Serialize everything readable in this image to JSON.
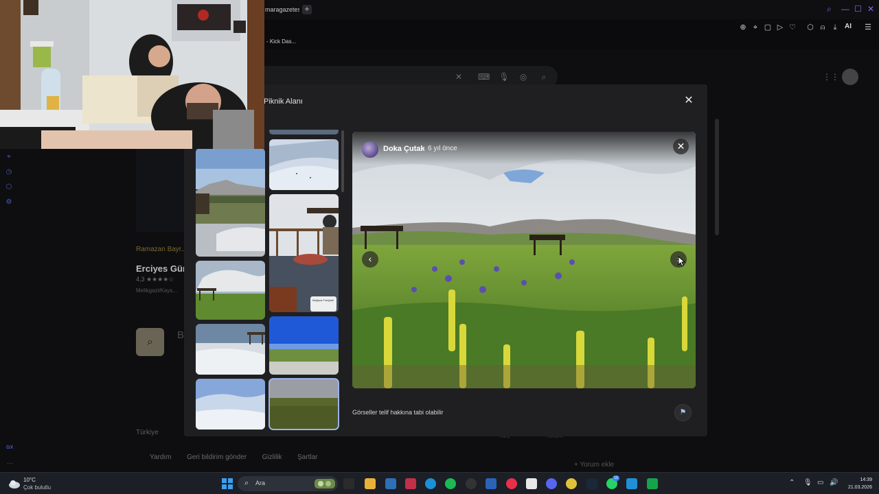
{
  "browser": {
    "tab_title": "maragazetes",
    "newtab_symbol": "+",
    "bookmark": "- Kick Das...",
    "ai_label": "AI",
    "accent": "#7b6cf6"
  },
  "page": {
    "owner_label": "Ramazan Bayr...",
    "place_name": "Erciyes Gün...",
    "rating": "4,3 ★★★★☆",
    "address": "Melikgazi/Kays...",
    "partial_letter": "B",
    "country": "Türkiye",
    "footer_links": [
      "Yardım",
      "Geri bildirim gönder",
      "Gizlilik",
      "Şartlar"
    ],
    "comment_button": "Yorum ekle",
    "bg_tag1": "Tarz",
    "bg_tag2": "Yorum"
  },
  "modal": {
    "title": "Piknik Alanı",
    "close_symbol": "✕",
    "viewer": {
      "author": "Doka Çutak",
      "separator": "·",
      "time_ago": "6 yıl önce",
      "prev_symbol": "‹",
      "next_symbol": "›",
      "close_symbol": "✕"
    },
    "copyright_notice": "Görseller telif hakkına tabi olabilir",
    "report_symbol": "⚑",
    "thumb_badge": "Mağaza Fotoğrafı"
  },
  "taskbar": {
    "temperature": "10°C",
    "weather": "Çok bulutlu",
    "search_label": "Ara",
    "notification_count": "10",
    "time": "14:39",
    "date": "21.03.2026"
  }
}
